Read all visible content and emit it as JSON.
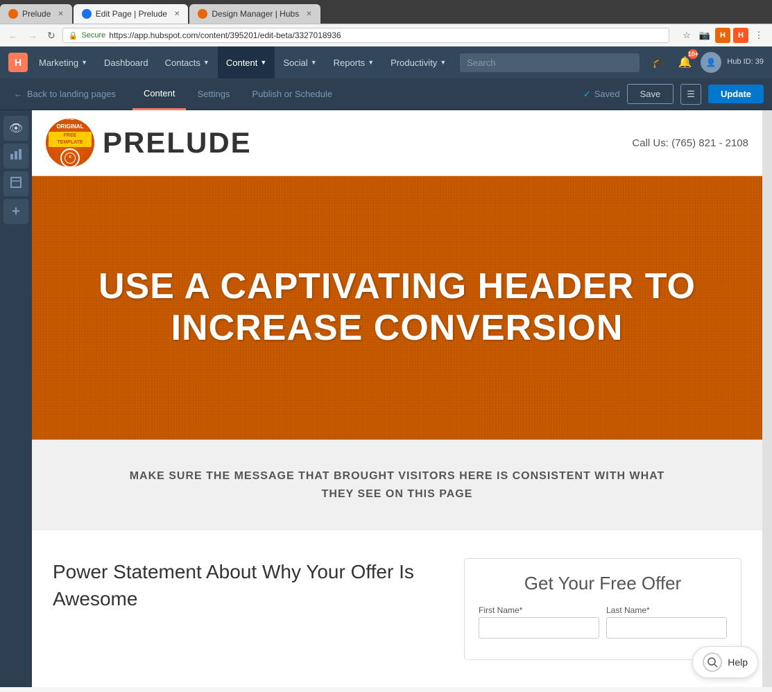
{
  "browser": {
    "tabs": [
      {
        "id": "tab1",
        "label": "Prelude",
        "favicon": "orange",
        "active": false
      },
      {
        "id": "tab2",
        "label": "Edit Page | Prelude",
        "favicon": "blue",
        "active": true
      },
      {
        "id": "tab3",
        "label": "Design Manager | Hubs",
        "favicon": "orange",
        "active": false
      }
    ],
    "url": "https://app.hubspot.com/content/395201/edit-beta/3327018936",
    "secure_text": "Secure"
  },
  "nav": {
    "marketing_label": "Marketing",
    "dashboard_label": "Dashboard",
    "contacts_label": "Contacts",
    "content_label": "Content",
    "social_label": "Social",
    "reports_label": "Reports",
    "productivity_label": "Productivity",
    "search_placeholder": "Search",
    "notifications_count": "10+",
    "user_initials": "",
    "hub_id": "Hub ID: 39"
  },
  "editor_toolbar": {
    "back_label": "Back to landing pages",
    "tabs": [
      {
        "id": "content",
        "label": "Content",
        "active": true
      },
      {
        "id": "settings",
        "label": "Settings",
        "active": false
      },
      {
        "id": "publish",
        "label": "Publish or Schedule",
        "active": false
      }
    ],
    "saved_status": "Saved",
    "save_label": "Save",
    "update_label": "Update"
  },
  "sidebar": {
    "icons": [
      {
        "name": "eye-icon",
        "symbol": "👁"
      },
      {
        "name": "chart-icon",
        "symbol": "📊"
      },
      {
        "name": "box-icon",
        "symbol": "⬜"
      },
      {
        "name": "add-icon",
        "symbol": "+"
      }
    ]
  },
  "landing_page": {
    "brand_name": "PRELUDE",
    "phone": "Call Us: (765) 821 - 2108",
    "logo_text": "ORIGINAL\nFREE TEMPLATE",
    "hero_heading": "USE A CAPTIVATING HEADER TO\nINCREASE CONVERSION",
    "message_text": "MAKE SURE THE MESSAGE THAT BROUGHT VISITORS HERE IS CONSISTENT WITH WHAT\nTHEY SEE ON THIS PAGE",
    "power_statement": "Power Statement About Why Your Offer Is Awesome",
    "form_title": "Get Your Free Offer",
    "form_fields": [
      {
        "label": "First Name*",
        "placeholder": ""
      },
      {
        "label": "Last Name*",
        "placeholder": ""
      }
    ]
  },
  "help": {
    "label": "Help"
  }
}
